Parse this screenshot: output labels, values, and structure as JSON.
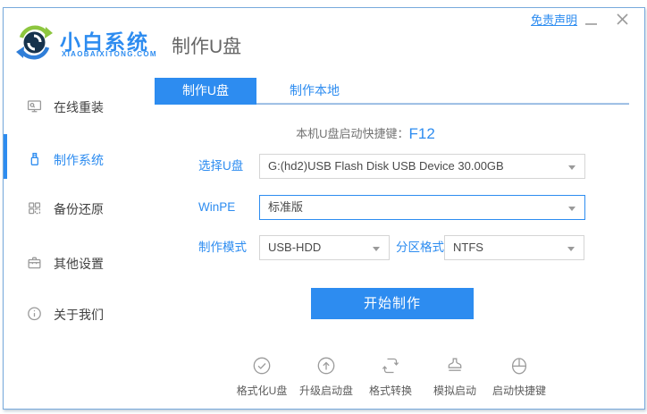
{
  "titlebar": {
    "disclaimer": "免责声明",
    "minimize_icon": "minimize-icon",
    "close_icon": "close-icon"
  },
  "brand": {
    "name": "小白系统",
    "domain": "XIAOBAIXITONG.COM",
    "page_title": "制作U盘",
    "logo_icon": "sync-arrows-globe-logo"
  },
  "sidebar": {
    "items": [
      {
        "label": "在线重装",
        "icon": "monitor-icon",
        "active": false
      },
      {
        "label": "制作系统",
        "icon": "usb-drive-icon",
        "active": true
      },
      {
        "label": "备份还原",
        "icon": "backup-grid-icon",
        "active": false
      },
      {
        "label": "其他设置",
        "icon": "briefcase-icon",
        "active": false
      },
      {
        "label": "关于我们",
        "icon": "info-circle-icon",
        "active": false
      }
    ]
  },
  "tabs": [
    {
      "label": "制作U盘",
      "active": true
    },
    {
      "label": "制作本地",
      "active": false
    }
  ],
  "hotkey": {
    "prefix": "本机U盘启动快捷键：",
    "key": "F12"
  },
  "form": {
    "usb_label": "选择U盘",
    "usb_value": "G:(hd2)USB Flash Disk USB Device 30.00GB",
    "winpe_label": "WinPE",
    "winpe_value": "标准版",
    "mode_label": "制作模式",
    "mode_value": "USB-HDD",
    "partition_label": "分区格式",
    "partition_value": "NTFS"
  },
  "start_button": "开始制作",
  "tools": [
    {
      "label": "格式化U盘",
      "icon": "check-circle-icon"
    },
    {
      "label": "升级启动盘",
      "icon": "arrow-up-circle-icon"
    },
    {
      "label": "格式转换",
      "icon": "convert-icon"
    },
    {
      "label": "模拟启动",
      "icon": "stamp-icon"
    },
    {
      "label": "启动快捷键",
      "icon": "mouse-icon"
    }
  ],
  "colors": {
    "primary": "#2d8cf0",
    "window_border": "#78aadc",
    "text_gray": "#666666",
    "icon_gray": "#9b9b9b",
    "tab_underline": "#9fc3e8"
  }
}
